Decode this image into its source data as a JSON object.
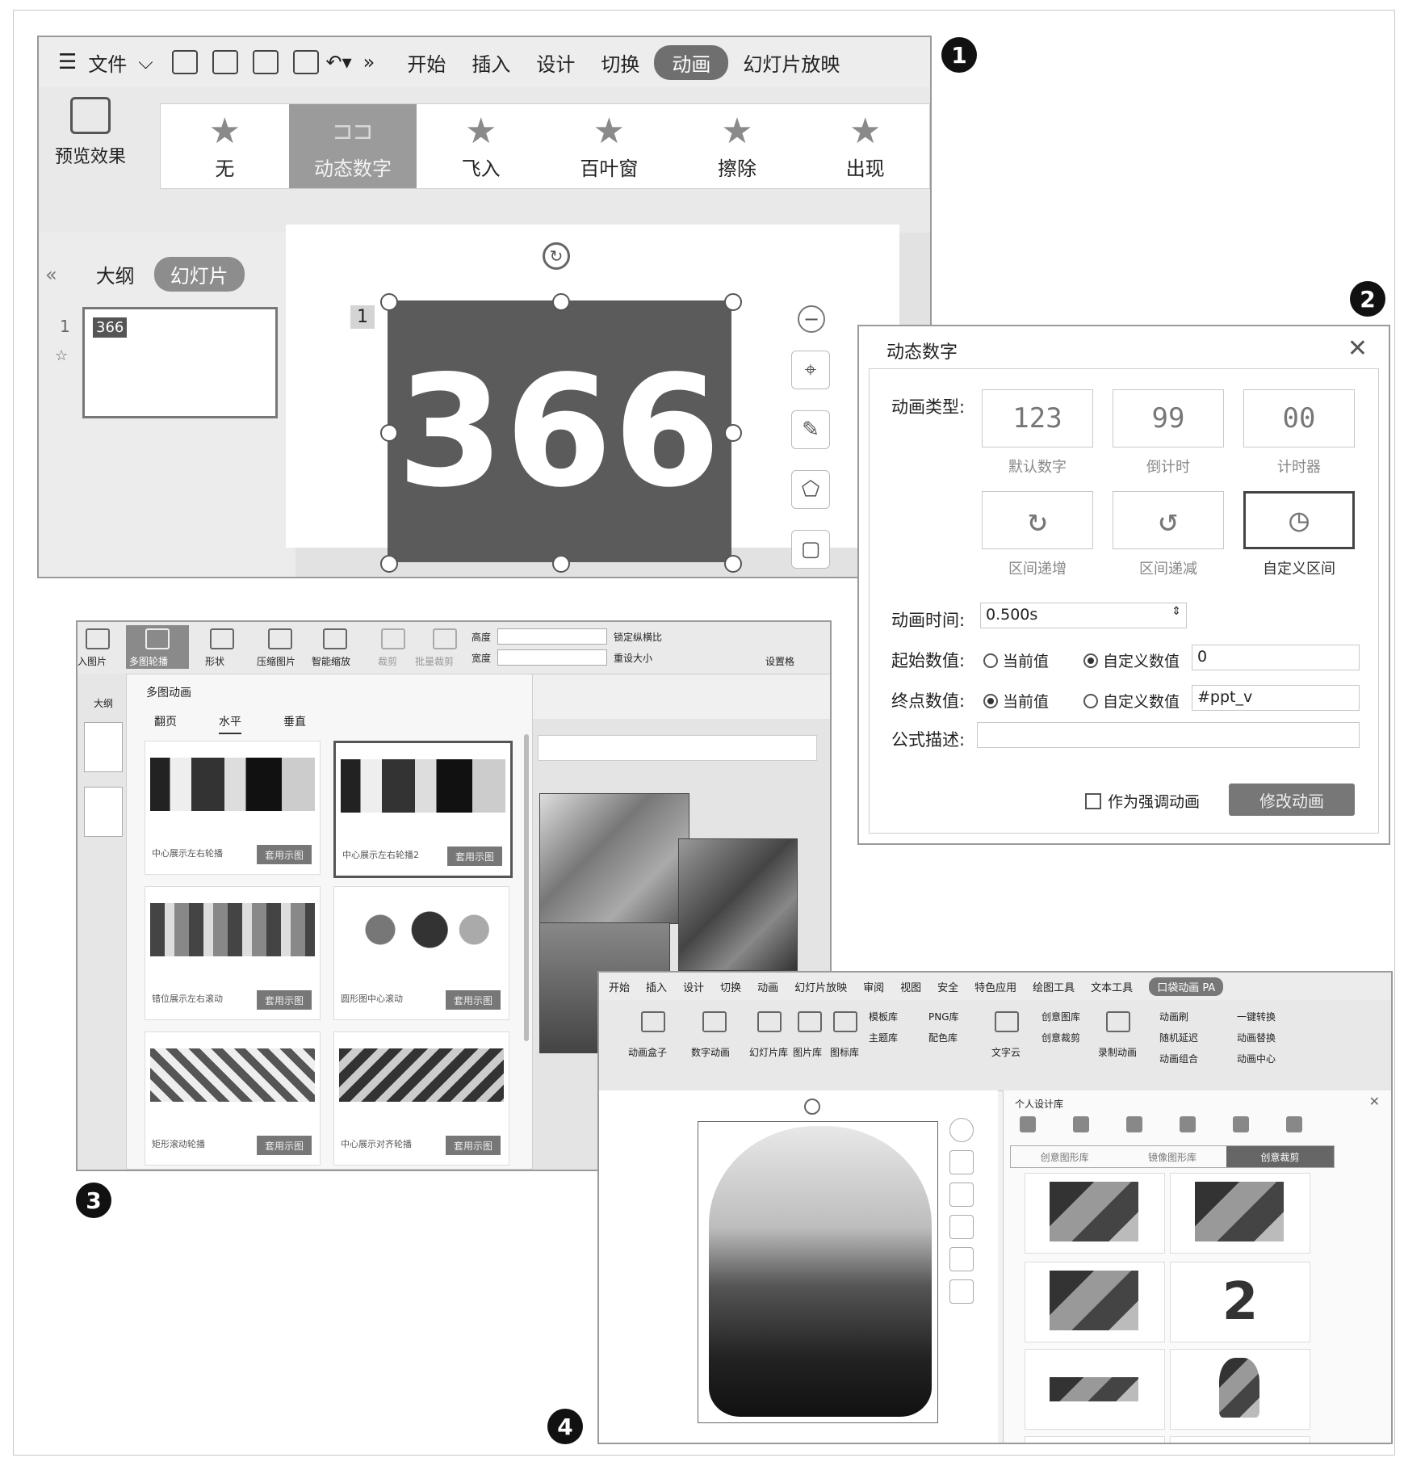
{
  "badges": {
    "b1": "1",
    "b2": "2",
    "b3": "3",
    "b4": "4"
  },
  "w1": {
    "menu": {
      "file": "文件",
      "tabs": [
        "开始",
        "插入",
        "设计",
        "切换",
        "动画",
        "幻灯片放映"
      ],
      "active_tab": "动画"
    },
    "preview": "预览效果",
    "gallery": [
      "无",
      "动态数字",
      "飞入",
      "百叶窗",
      "擦除",
      "出现"
    ],
    "pane": {
      "outline": "大纲",
      "slides": "幻灯片",
      "slide_no": "1",
      "thumb_value": "366"
    },
    "slide": {
      "anim_tag": "1",
      "number": "366"
    }
  },
  "w2": {
    "title": "动态数字",
    "type_label": "动画类型:",
    "types": [
      {
        "display": "123",
        "caption": "默认数字"
      },
      {
        "display": "99",
        "caption": "倒计时"
      },
      {
        "display": "00",
        "caption": "计时器"
      },
      {
        "display": "↻",
        "caption": "区间递增"
      },
      {
        "display": "↺",
        "caption": "区间递减"
      },
      {
        "display": "◷",
        "caption": "自定义区间"
      }
    ],
    "time_label": "动画时间:",
    "time_value": "0.500s",
    "start_label": "起始数值:",
    "start_current": "当前值",
    "start_custom": "自定义数值",
    "start_value": "0",
    "end_label": "终点数值:",
    "end_current": "当前值",
    "end_custom": "自定义数值",
    "end_value": "#ppt_v",
    "formula_label": "公式描述:",
    "formula_value": "",
    "emphasis": "作为强调动画",
    "modify": "修改动画"
  },
  "w3": {
    "ribbon": [
      "入图片",
      "多图轮播",
      "形状",
      "压缩图片",
      "智能缩放",
      "裁剪",
      "批量裁剪"
    ],
    "size": {
      "height": "高度",
      "width": "宽度",
      "lock": "锁定纵横比",
      "reset": "重设大小",
      "more": "设置格"
    },
    "popup_title": "多图动画",
    "popup_tabs": [
      "翻页",
      "水平",
      "垂直"
    ],
    "cards": [
      {
        "name": "中心展示左右轮播",
        "use": "套用示图"
      },
      {
        "name": "中心展示左右轮播2",
        "use": "套用示图"
      },
      {
        "name": "错位展示左右滚动",
        "use": "套用示图"
      },
      {
        "name": "圆形图中心滚动",
        "use": "套用示图"
      },
      {
        "name": "矩形滚动轮播",
        "use": "套用示图"
      },
      {
        "name": "中心展示对齐轮播",
        "use": "套用示图"
      }
    ],
    "outline": "大纲"
  },
  "w4": {
    "menu": [
      "开始",
      "插入",
      "设计",
      "切换",
      "动画",
      "幻灯片放映",
      "审阅",
      "视图",
      "安全",
      "特色应用",
      "绘图工具",
      "文本工具",
      "口袋动画 PA"
    ],
    "ribbon": [
      "动画盒子",
      "数字动画",
      "幻灯片库",
      "图片库",
      "图标库",
      "模板库",
      "主题库",
      "PNG库",
      "配色库",
      "文字云",
      "创意图库",
      "创意裁剪",
      "录制动画",
      "动画刷",
      "随机延迟",
      "动画组合",
      "一键转换",
      "动画替换",
      "动画中心"
    ],
    "panel_title": "个人设计库",
    "panel_tabs": [
      "创意图形库",
      "镜像图形库",
      "创意裁剪"
    ],
    "tiles": [
      {
        "glyph": ""
      },
      {
        "glyph": ""
      },
      {
        "glyph": ""
      },
      {
        "glyph": "2"
      },
      {
        "glyph": ""
      },
      {
        "glyph": ""
      },
      {
        "glyph": ""
      },
      {
        "glyph": ""
      }
    ]
  }
}
